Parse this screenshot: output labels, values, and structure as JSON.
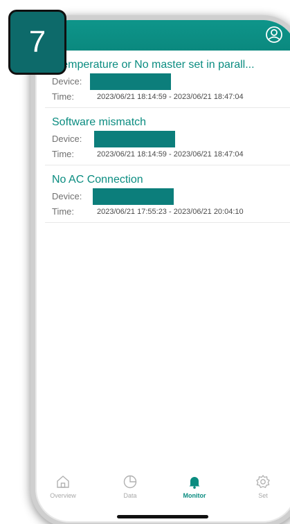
{
  "step_badge": "7",
  "colors": {
    "accent": "#0a8c80",
    "header": "#0e958a",
    "redaction": "#0c7e7b"
  },
  "alarms": [
    {
      "title": "r temperature or No master set in parall...",
      "device_label": "Device:",
      "time_label": "Time:",
      "time_range": "2023/06/21 18:14:59 - 2023/06/21 18:47:04"
    },
    {
      "title": "Software mismatch",
      "device_label": "Device:",
      "time_label": "Time:",
      "time_range": "2023/06/21 18:14:59 - 2023/06/21 18:47:04"
    },
    {
      "title": "No AC Connection",
      "device_label": "Device:",
      "time_label": "Time:",
      "time_range": "2023/06/21 17:55:23 - 2023/06/21 20:04:10"
    }
  ],
  "tabs": [
    {
      "label": "Overview",
      "icon": "home-icon"
    },
    {
      "label": "Data",
      "icon": "pie-chart-icon"
    },
    {
      "label": "Monitor",
      "icon": "bell-icon",
      "active": true
    },
    {
      "label": "Set",
      "icon": "gear-icon"
    }
  ]
}
